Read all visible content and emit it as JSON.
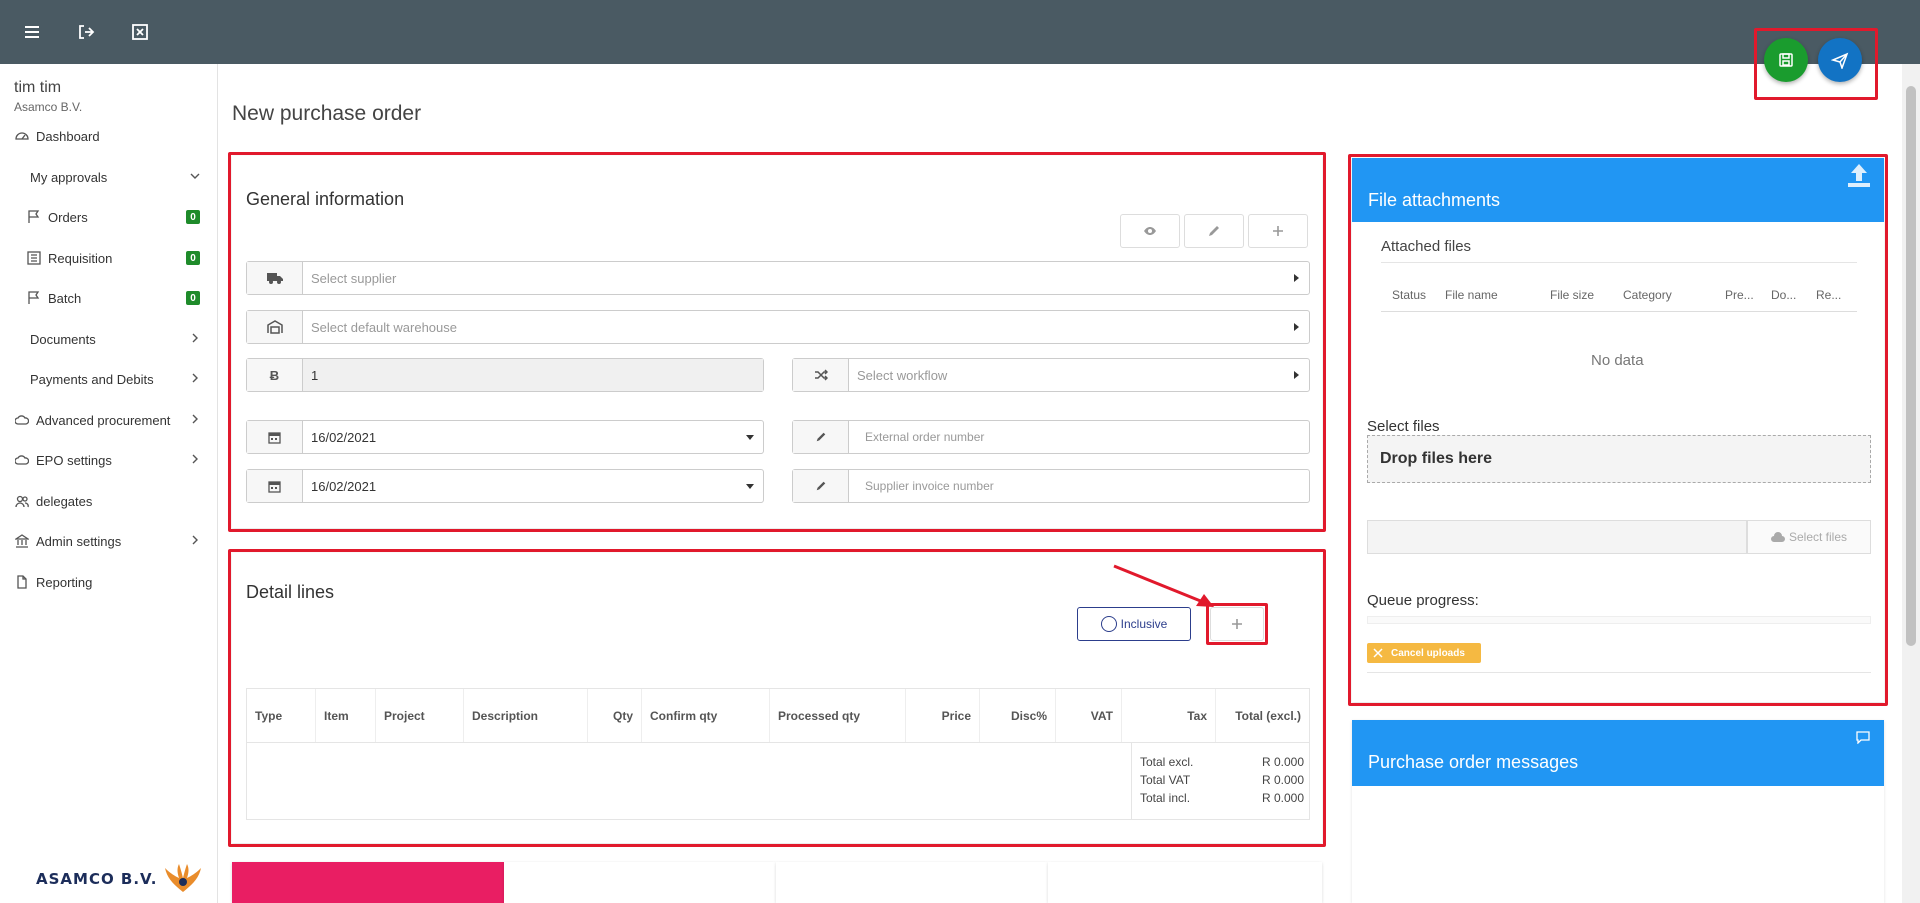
{
  "sidebar": {
    "user_name": "tim tim",
    "user_company": "Asamco B.V.",
    "items": [
      {
        "label": "Dashboard",
        "icon": "dashboard-icon"
      },
      {
        "label": "My approvals",
        "icon": ""
      },
      {
        "label": "Orders",
        "icon": "flag-icon",
        "badge": "0"
      },
      {
        "label": "Requisition",
        "icon": "list-icon",
        "badge": "0"
      },
      {
        "label": "Batch",
        "icon": "flag-icon",
        "badge": "0"
      },
      {
        "label": "Documents",
        "icon": ""
      },
      {
        "label": "Payments and Debits",
        "icon": ""
      },
      {
        "label": "Advanced procurement",
        "icon": "cloud-icon"
      },
      {
        "label": "EPO settings",
        "icon": "cloud-icon"
      },
      {
        "label": "delegates",
        "icon": "users-icon"
      },
      {
        "label": "Admin settings",
        "icon": "bank-icon"
      },
      {
        "label": "Reporting",
        "icon": "file-icon"
      }
    ],
    "logo_text": "ASAMCO B.V."
  },
  "page": {
    "title": "New purchase order"
  },
  "general": {
    "title": "General information",
    "supplier_placeholder": "Select supplier",
    "warehouse_placeholder": "Select default warehouse",
    "number_value": "1",
    "workflow_placeholder": "Select workflow",
    "date1": "16/02/2021",
    "date2": "16/02/2021",
    "external_order_placeholder": "External order number",
    "supplier_invoice_placeholder": "Supplier invoice number"
  },
  "detail": {
    "title": "Detail lines",
    "inclusive_label": "Inclusive",
    "columns": [
      "Type",
      "Item",
      "Project",
      "Description",
      "Qty",
      "Confirm qty",
      "Processed qty",
      "Price",
      "Disc%",
      "VAT",
      "Tax",
      "Total (excl.)"
    ],
    "totals": [
      {
        "label": "Total excl.",
        "value": "R 0.000"
      },
      {
        "label": "Total VAT",
        "value": "R 0.000"
      },
      {
        "label": "Total incl.",
        "value": "R 0.000"
      }
    ]
  },
  "attachments": {
    "title": "File attachments",
    "attached_files": "Attached files",
    "columns": [
      "Status",
      "File name",
      "File size",
      "Category",
      "Pre...",
      "Do...",
      "Re..."
    ],
    "no_data": "No data",
    "select_files_label": "Select files",
    "drop_text": "Drop files here",
    "select_files_button": "Select files",
    "queue_progress": "Queue progress:",
    "cancel_uploads": "Cancel uploads"
  },
  "messages": {
    "title": "Purchase order messages"
  },
  "colors": {
    "topbar": "#4a5a63",
    "save_green": "#1a9c2e",
    "send_blue": "#1273c4",
    "panel_blue": "#2196f3",
    "highlight_red": "#e1192c",
    "tile_pink": "#e91e63"
  }
}
